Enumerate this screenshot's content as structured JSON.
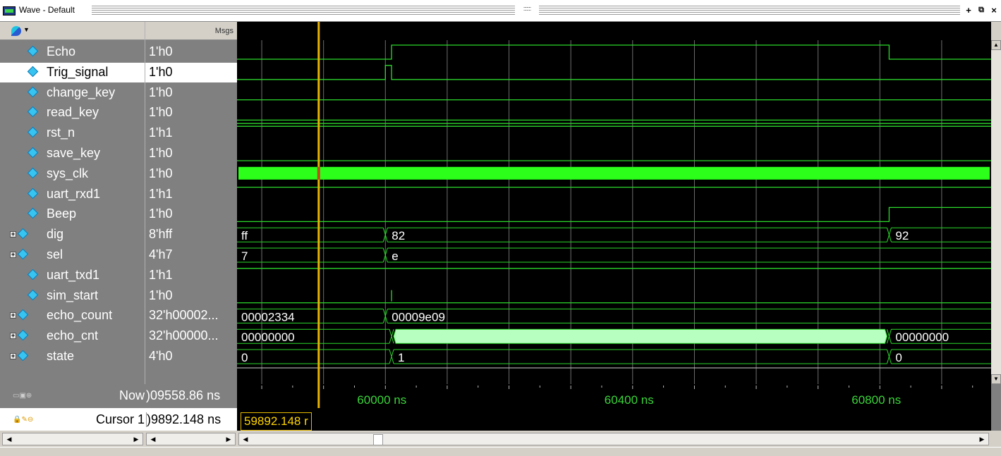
{
  "window": {
    "title": "Wave - Default",
    "grip": ":::::::"
  },
  "header": {
    "msgs_label": "Msgs"
  },
  "signals": [
    {
      "name": "Echo",
      "value": "1'h0",
      "expandable": false
    },
    {
      "name": "Trig_signal",
      "value": "1'h0",
      "expandable": false
    },
    {
      "name": "change_key",
      "value": "1'h0",
      "expandable": false
    },
    {
      "name": "read_key",
      "value": "1'h0",
      "expandable": false
    },
    {
      "name": "rst_n",
      "value": "1'h1",
      "expandable": false
    },
    {
      "name": "save_key",
      "value": "1'h0",
      "expandable": false
    },
    {
      "name": "sys_clk",
      "value": "1'h0",
      "expandable": false
    },
    {
      "name": "uart_rxd1",
      "value": "1'h1",
      "expandable": false
    },
    {
      "name": "Beep",
      "value": "1'h0",
      "expandable": false
    },
    {
      "name": "dig",
      "value": "8'hff",
      "expandable": true
    },
    {
      "name": "sel",
      "value": "4'h7",
      "expandable": true
    },
    {
      "name": "uart_txd1",
      "value": "1'h1",
      "expandable": false
    },
    {
      "name": "sim_start",
      "value": "1'h0",
      "expandable": false
    },
    {
      "name": "echo_count",
      "value": "32'h00002...",
      "expandable": true
    },
    {
      "name": "echo_cnt",
      "value": "32'h00000...",
      "expandable": true
    },
    {
      "name": "state",
      "value": "4'h0",
      "expandable": true
    }
  ],
  "selected_signal": "Trig_signal",
  "bus_labels": {
    "dig": [
      "ff",
      "82",
      "92"
    ],
    "sel": [
      "7",
      "e"
    ],
    "echo_count": [
      "00002334",
      "00009e09"
    ],
    "echo_cnt": [
      "00000000",
      "00000000"
    ],
    "state": [
      "0",
      "1",
      "0"
    ]
  },
  "time": {
    "now_label": "Now",
    "now_value": ")09558.86 ns",
    "cursor_label": "Cursor 1",
    "cursor_value": ")9892.148 ns",
    "cursor_tag": "59892.148 r",
    "ticks": [
      "60000 ns",
      "60400 ns",
      "60800 ns"
    ],
    "cursor_time": 59892.148,
    "view_start": 59760,
    "view_end": 60980
  },
  "colors": {
    "signal": "#2bd92b",
    "clock_fill": "#2bff1a",
    "bus_fill": "#b6ffc0",
    "cursor": "#e6b400",
    "grid": "#6e6e6e",
    "tick_text": "#3ad43a",
    "wave_bg": "#000000"
  },
  "icons": {
    "palette": "palette-icon",
    "signal": "diamond-signal-icon",
    "expand": "expand-plus-icon",
    "now": "now-toolbar-icon",
    "cursor": "cursor-lock-icon"
  }
}
